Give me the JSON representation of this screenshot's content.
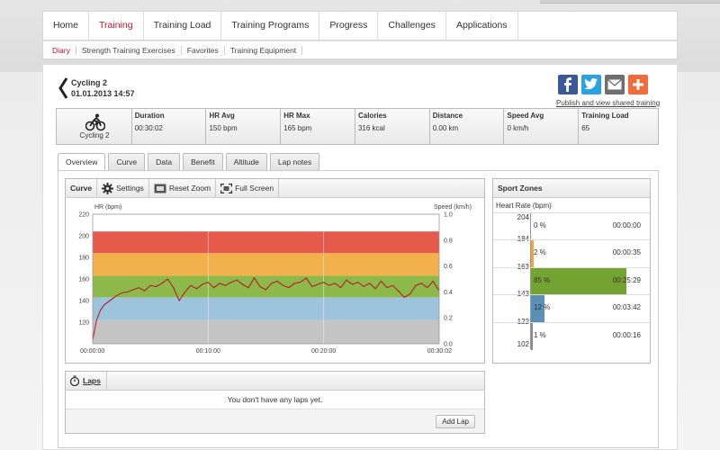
{
  "nav": {
    "items": [
      {
        "label": "Home"
      },
      {
        "label": "Training"
      },
      {
        "label": "Training Load"
      },
      {
        "label": "Training Programs"
      },
      {
        "label": "Progress"
      },
      {
        "label": "Challenges"
      },
      {
        "label": "Applications"
      }
    ],
    "active_index": 1
  },
  "subnav": {
    "items": [
      {
        "label": "Diary"
      },
      {
        "label": "Strength Training Exercises"
      },
      {
        "label": "Favorites"
      },
      {
        "label": "Training Equipment"
      }
    ],
    "active_index": 0
  },
  "exercise": {
    "title": "Cycling 2",
    "datetime": "01.01.2013 14:57",
    "sport_label": "Cycling 2"
  },
  "share": {
    "text": "Publish and view shared training",
    "icons": [
      "facebook-icon",
      "twitter-icon",
      "email-icon",
      "plus-icon"
    ],
    "colors": [
      "#3b5998",
      "#2aa3e0",
      "#6f6f6f",
      "#f26b3a"
    ]
  },
  "summary": [
    {
      "label": "Duration",
      "value": "00:30:02"
    },
    {
      "label": "HR Avg",
      "value": "150   bpm"
    },
    {
      "label": "HR Max",
      "value": "165   bpm"
    },
    {
      "label": "Calories",
      "value": "316   kcal"
    },
    {
      "label": "Distance",
      "value": "0.00   km"
    },
    {
      "label": "Speed Avg",
      "value": "0   km/h"
    },
    {
      "label": "Training Load",
      "value": "65"
    }
  ],
  "tabs": [
    {
      "label": "Overview"
    },
    {
      "label": "Curve"
    },
    {
      "label": "Data"
    },
    {
      "label": "Benefit"
    },
    {
      "label": "Altitude"
    },
    {
      "label": "Lap notes"
    }
  ],
  "active_tab": 0,
  "chart_toolbar": {
    "title": "Curve",
    "settings": "Settings",
    "reset_zoom": "Reset Zoom",
    "full_screen": "Full Screen"
  },
  "chart_data": {
    "type": "line",
    "ylabel": "HR (bpm)",
    "y2label": "Speed (km/h)",
    "ylim": [
      100,
      220
    ],
    "y2lim": [
      0.0,
      1.0
    ],
    "yticks": [
      "220",
      "200",
      "180",
      "160",
      "140",
      "120"
    ],
    "y2ticks": [
      "1.0",
      "0.8",
      "0.6",
      "0.4",
      "0.2",
      "0.0"
    ],
    "xticks": [
      "00:00:00",
      "00:10:00",
      "00:20:00",
      "00:30:02"
    ],
    "xlim_seconds": [
      0,
      1802
    ],
    "zone_bands": [
      {
        "from": 100,
        "to": 122,
        "color": "#c4c4c4"
      },
      {
        "from": 122,
        "to": 143,
        "color": "#9dc4dc"
      },
      {
        "from": 143,
        "to": 163,
        "color": "#8db84a"
      },
      {
        "from": 163,
        "to": 184,
        "color": "#f2b14a"
      },
      {
        "from": 184,
        "to": 204,
        "color": "#e55a4a"
      }
    ],
    "series": [
      {
        "name": "",
        "color": "#b0202a",
        "x_seconds": [
          0,
          20,
          40,
          60,
          90,
          120,
          150,
          180,
          210,
          240,
          270,
          300,
          330,
          360,
          390,
          420,
          450,
          480,
          510,
          540,
          570,
          600,
          630,
          660,
          690,
          720,
          750,
          780,
          810,
          840,
          870,
          900,
          930,
          960,
          990,
          1020,
          1050,
          1080,
          1110,
          1140,
          1170,
          1200,
          1230,
          1260,
          1290,
          1320,
          1350,
          1380,
          1410,
          1440,
          1470,
          1500,
          1530,
          1560,
          1590,
          1620,
          1650,
          1680,
          1710,
          1740,
          1770,
          1802
        ],
        "values": [
          104,
          122,
          131,
          136,
          140,
          144,
          147,
          148,
          150,
          152,
          149,
          154,
          153,
          156,
          160,
          152,
          140,
          148,
          154,
          151,
          155,
          157,
          152,
          156,
          154,
          157,
          159,
          155,
          152,
          161,
          153,
          150,
          156,
          158,
          154,
          152,
          156,
          157,
          161,
          153,
          155,
          157,
          154,
          156,
          152,
          159,
          155,
          157,
          153,
          156,
          151,
          158,
          152,
          154,
          149,
          143,
          146,
          154,
          156,
          152,
          158,
          149
        ]
      }
    ]
  },
  "laps": {
    "title": "Laps",
    "empty_text": "You don't have any laps yet.",
    "add_button": "Add Lap"
  },
  "zones": {
    "title": "Sport Zones",
    "subtitle": "Heart Rate (bpm)",
    "limits": [
      "204",
      "184",
      "163",
      "143",
      "122",
      "102"
    ],
    "rows": [
      {
        "pct_label": "0 %",
        "pct": 0,
        "time": "00:00:00",
        "color": "#d63a2b"
      },
      {
        "pct_label": "2 %",
        "pct": 2,
        "time": "00:00:35",
        "color": "#f2a43a"
      },
      {
        "pct_label": "85 %",
        "pct": 85,
        "time": "00:25:29",
        "color": "#74a332"
      },
      {
        "pct_label": "12 %",
        "pct": 12,
        "time": "00:03:42",
        "color": "#5a8fb8"
      },
      {
        "pct_label": "1 %",
        "pct": 1,
        "time": "00:00:16",
        "color": "#8a8a8a"
      }
    ]
  }
}
